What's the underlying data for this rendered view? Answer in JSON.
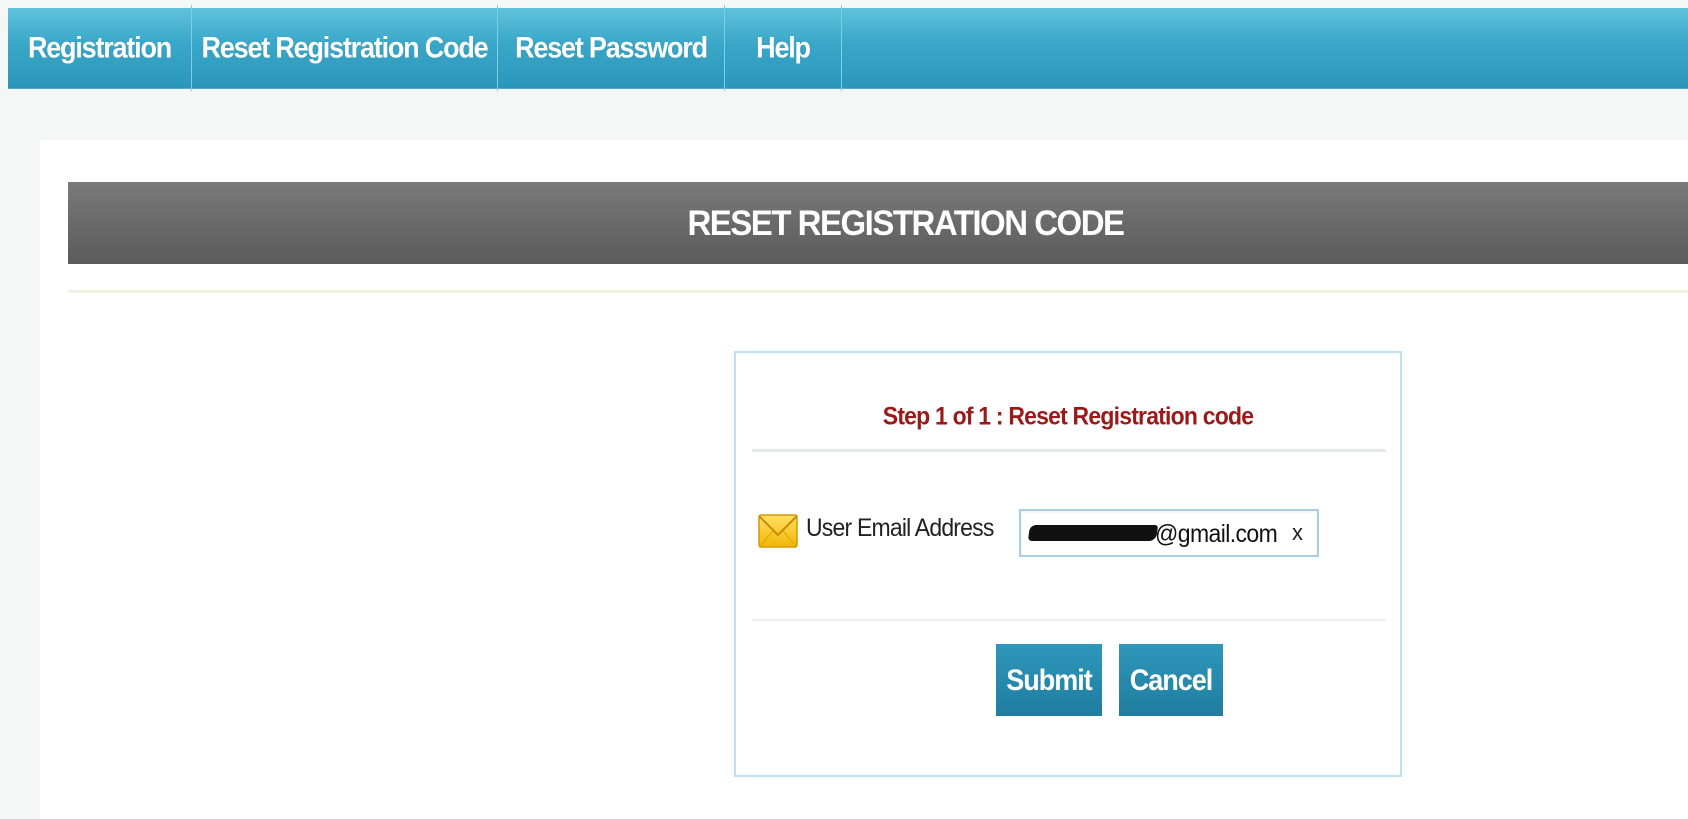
{
  "nav": {
    "items": [
      {
        "label": "Registration"
      },
      {
        "label": "Reset Registration Code"
      },
      {
        "label": "Reset Password"
      },
      {
        "label": "Help"
      }
    ]
  },
  "banner": {
    "title": "RESET REGISTRATION CODE"
  },
  "form": {
    "step_title": "Step 1 of 1 : Reset Registration code",
    "email_label": "User Email Address",
    "email_value_visible": "@gmail.com",
    "clear_symbol": "x",
    "submit_label": "Submit",
    "cancel_label": "Cancel"
  },
  "icons": {
    "email": "envelope-icon",
    "clear": "close-icon"
  },
  "colors": {
    "nav": "#3aa6c8",
    "banner": "#6a6a6a",
    "step_title": "#9a1a1a",
    "button": "#2589ad"
  }
}
